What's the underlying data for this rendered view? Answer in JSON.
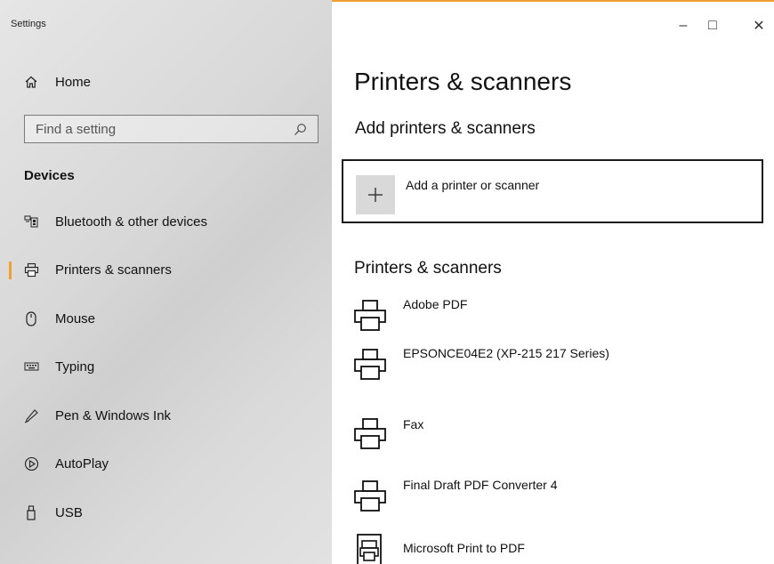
{
  "window": {
    "app_title": "Settings",
    "minimize": "–",
    "maximize": "□",
    "close": "✕",
    "accent_color": "#f0a030"
  },
  "sidebar": {
    "home_label": "Home",
    "search_placeholder": "Find a setting",
    "section_heading": "Devices",
    "items": [
      {
        "label": "Bluetooth & other devices",
        "icon": "bluetooth-devices-icon"
      },
      {
        "label": "Printers & scanners",
        "icon": "printer-icon",
        "active": true
      },
      {
        "label": "Mouse",
        "icon": "mouse-icon"
      },
      {
        "label": "Typing",
        "icon": "keyboard-icon"
      },
      {
        "label": "Pen & Windows Ink",
        "icon": "pen-icon"
      },
      {
        "label": "AutoPlay",
        "icon": "autoplay-icon"
      },
      {
        "label": "USB",
        "icon": "usb-icon"
      }
    ]
  },
  "main": {
    "page_title": "Printers & scanners",
    "add_section_heading": "Add printers & scanners",
    "add_button_label": "Add a printer or scanner",
    "list_heading": "Printers & scanners",
    "printers": [
      {
        "name": "Adobe PDF"
      },
      {
        "name": "EPSONCE04E2 (XP-215 217 Series)"
      },
      {
        "name": "Fax"
      },
      {
        "name": "Final Draft PDF Converter 4"
      },
      {
        "name": "Microsoft Print to PDF"
      }
    ]
  }
}
